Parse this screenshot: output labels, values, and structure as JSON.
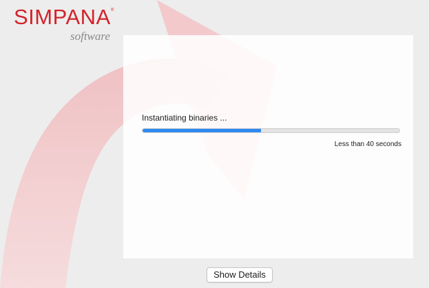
{
  "brand": {
    "name": "SIMPANA",
    "registered_mark": "®",
    "tagline": "software"
  },
  "progress": {
    "status_text": "Instantiating binaries ...",
    "fraction": 0.46,
    "eta_text": "Less than 40 seconds",
    "fill_color": "#2f89f0"
  },
  "footer": {
    "details_button_label": "Show Details"
  },
  "colors": {
    "brand_red": "#d2232a",
    "swoosh": "#f2c7c9"
  }
}
